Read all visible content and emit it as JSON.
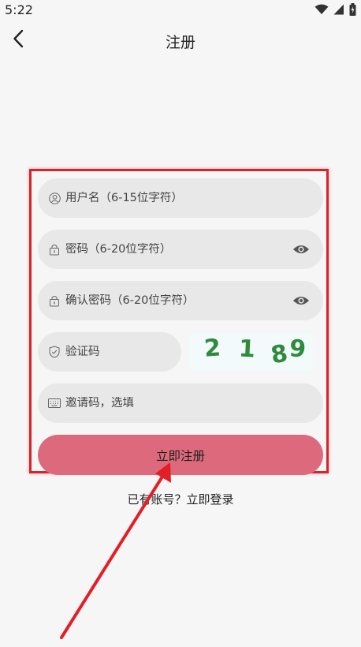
{
  "status_bar": {
    "time": "5:22",
    "icons": [
      "wifi-icon",
      "signal-icon",
      "battery-icon"
    ]
  },
  "header": {
    "title": "注册",
    "back_icon": "chevron-left-icon"
  },
  "form": {
    "username": {
      "placeholder": "用户名（6-15位字符）",
      "value": "",
      "icon": "user-icon"
    },
    "password": {
      "placeholder": "密码（6-20位字符）",
      "value": "",
      "icon": "lock-icon",
      "toggle_icon": "eye-icon"
    },
    "confirm_password": {
      "placeholder": "确认密码（6-20位字符）",
      "value": "",
      "icon": "lock-icon",
      "toggle_icon": "eye-icon"
    },
    "captcha": {
      "placeholder": "验证码",
      "value": "",
      "icon": "shield-icon",
      "image_chars": [
        "2",
        "1",
        "8",
        "9"
      ],
      "image_color": "#2f8a3c"
    },
    "invite": {
      "placeholder": "邀请码，选填",
      "value": "",
      "icon": "keyboard-icon"
    },
    "submit_label": "立即注册"
  },
  "footer": {
    "have_account_text": "已有账号？",
    "login_link": "立即登录"
  },
  "colors": {
    "background": "#f6f6f6",
    "field_bg": "#e8e8e8",
    "submit_bg": "#dd6a7c",
    "annotation_red": "#d9232b"
  }
}
